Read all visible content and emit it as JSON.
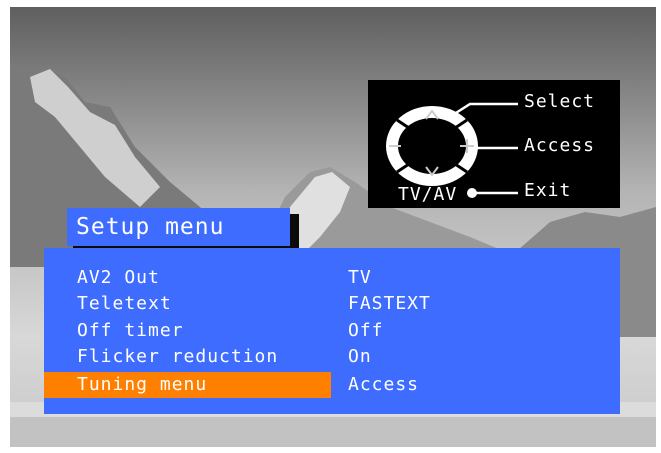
{
  "legend": {
    "select_label": "Select",
    "access_label": "Access",
    "exit_label": "Exit",
    "tvav_label": "TV/AV"
  },
  "menu": {
    "title": "Setup menu",
    "items": [
      {
        "label": "AV2 Out",
        "value": "TV",
        "selected": false
      },
      {
        "label": "Teletext",
        "value": "FASTEXT",
        "selected": false
      },
      {
        "label": "Off timer",
        "value": "Off",
        "selected": false
      },
      {
        "label": "Flicker reduction",
        "value": "On",
        "selected": false
      },
      {
        "label": "Tuning menu",
        "value": "Access",
        "selected": true
      }
    ]
  },
  "colors": {
    "menu_blue": "#3d6cff",
    "highlight_orange": "#ff8000",
    "legend_black": "#000000"
  },
  "icons": [
    "remote-control-dpad-icon",
    "up-arrow-icon",
    "down-arrow-icon",
    "plus-icon",
    "minus-icon",
    "exit-dot-icon"
  ]
}
